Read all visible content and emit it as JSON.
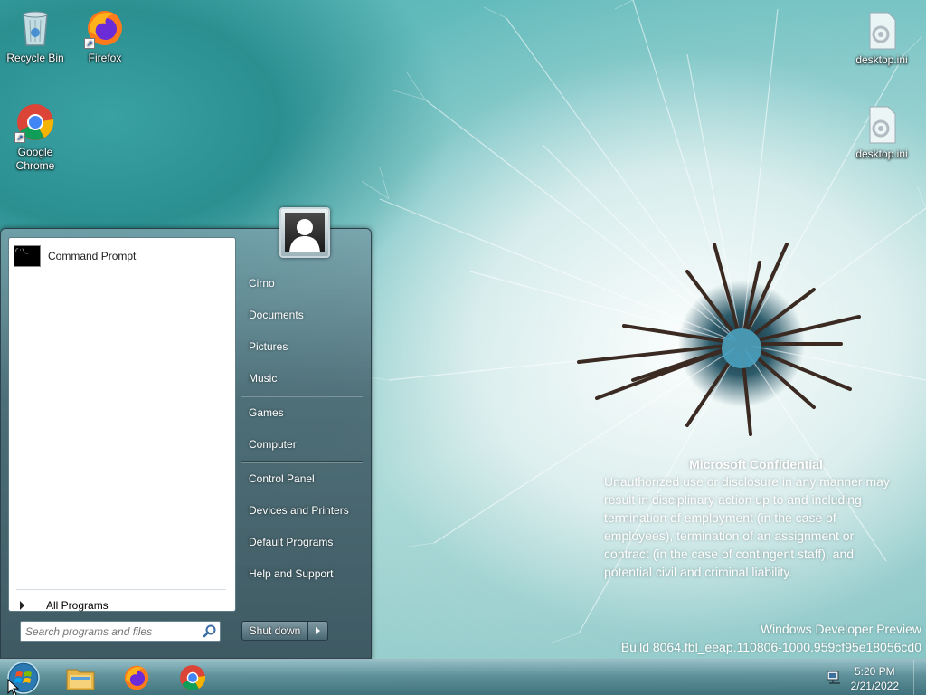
{
  "desktop": {
    "icons": [
      {
        "label": "Recycle Bin",
        "icon": "recycle-bin-icon"
      },
      {
        "label": "Firefox",
        "icon": "firefox-icon"
      },
      {
        "label": "Google Chrome",
        "icon": "chrome-icon"
      },
      {
        "label": "desktop.ini",
        "icon": "ini-file-icon"
      },
      {
        "label": "desktop.ini",
        "icon": "ini-file-icon"
      }
    ]
  },
  "start_menu": {
    "programs": [
      {
        "label": "Command Prompt",
        "icon": "command-prompt-icon",
        "icon_text": "C:\\_"
      }
    ],
    "all_programs_label": "All Programs",
    "search": {
      "placeholder": "Search programs and files",
      "value": ""
    },
    "right_items": [
      {
        "label": "Cirno"
      },
      {
        "label": "Documents"
      },
      {
        "label": "Pictures"
      },
      {
        "label": "Music"
      },
      {
        "label": "Games"
      },
      {
        "label": "Computer"
      },
      {
        "label": "Control Panel"
      },
      {
        "label": "Devices and Printers"
      },
      {
        "label": "Default Programs"
      },
      {
        "label": "Help and Support"
      }
    ],
    "shutdown_label": "Shut down"
  },
  "watermark": {
    "heading": "Microsoft Confidential",
    "lines": [
      "Unauthorized use or disclosure in any manner may",
      "result in disciplinary action up to and including",
      "termination of employment (in the case of",
      "employees), termination of an assignment or",
      "contract (in the case of contingent staff), and",
      "potential civil and criminal liability."
    ],
    "build_line1": "Windows Developer Preview",
    "build_line2": "Build 8064.fbl_eeap.110806-1000.959cf95e18056cd0"
  },
  "taskbar": {
    "pinned": [
      {
        "icon": "file-explorer-icon"
      },
      {
        "icon": "firefox-icon"
      },
      {
        "icon": "chrome-icon"
      }
    ],
    "clock_time": "5:20 PM",
    "clock_date": "2/21/2022"
  },
  "colors": {
    "accent_teal": "#49b0b0",
    "start_menu_glass": "#46646e",
    "text_white": "#ffffff"
  }
}
